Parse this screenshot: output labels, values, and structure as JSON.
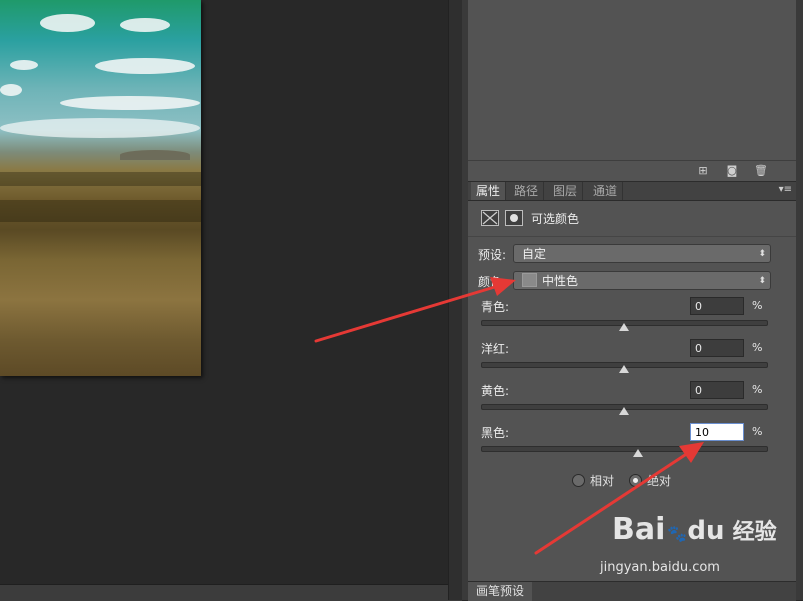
{
  "properties_panel": {
    "tabs": [
      {
        "label": "属性",
        "active": true
      },
      {
        "label": "路径",
        "active": false
      },
      {
        "label": "图层",
        "active": false
      },
      {
        "label": "通道",
        "active": false
      }
    ],
    "adjustment_title": "可选颜色",
    "preset_label": "预设:",
    "preset_value": "自定",
    "colors_label": "颜色:",
    "colors_value": "中性色",
    "sliders": [
      {
        "label": "青色:",
        "value": "0",
        "unit": "%",
        "level": 0.5
      },
      {
        "label": "洋红:",
        "value": "0",
        "unit": "%",
        "level": 0.5
      },
      {
        "label": "黄色:",
        "value": "0",
        "unit": "%",
        "level": 0.5
      },
      {
        "label": "黑色:",
        "value": "10",
        "unit": "%",
        "level": 0.55
      }
    ],
    "method_relative": "相对",
    "method_absolute": "绝对",
    "method_selected": "绝对"
  },
  "bottom_panel": {
    "tab_label": "画笔预设"
  },
  "watermark": {
    "logo_text": "Bai",
    "logo_suffix": "du",
    "brand_cn": "经验",
    "url": "jingyan.baidu.com"
  },
  "colors": {
    "panel_bg": "#535353",
    "canvas_bg": "#282828",
    "annotation_arrow": "#e53935"
  },
  "icons": [
    "new-snapshot-icon",
    "camera-icon",
    "trash-icon",
    "panel-menu-icon",
    "adjustment-layer-icon",
    "mask-icon",
    "dropdown-arrow-icon"
  ]
}
